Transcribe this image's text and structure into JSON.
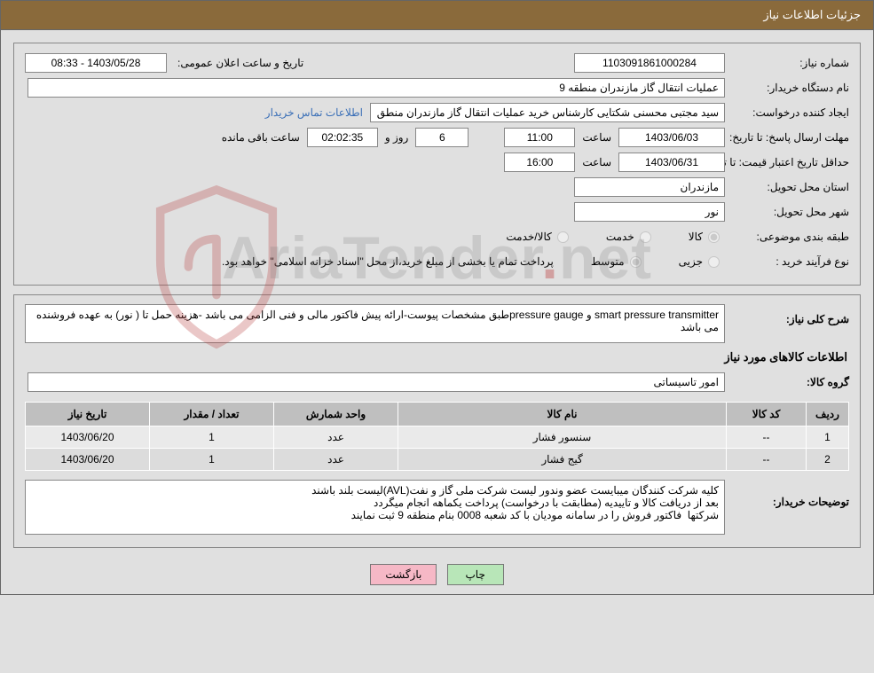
{
  "header": {
    "title": "جزئیات اطلاعات نیاز"
  },
  "info1": {
    "need_number_label": "شماره نیاز:",
    "need_number": "1103091861000284",
    "announce_label": "تاریخ و ساعت اعلان عمومی:",
    "announce_value": "08:33 - 1403/05/28",
    "buyer_org_label": "نام دستگاه خریدار:",
    "buyer_org": "عملیات انتقال گاز مازندران منطقه 9",
    "requester_label": "ایجاد کننده درخواست:",
    "requester": "سید مجتبی محسنی شکتایی کارشناس خرید عملیات انتقال گاز مازندران منطق",
    "contact_link": "اطلاعات تماس خریدار",
    "reply_deadline_label": "مهلت ارسال پاسخ:  تا تاریخ:",
    "reply_date": "1403/06/03",
    "time_label": "ساعت",
    "reply_time": "11:00",
    "days_value": "6",
    "days_label": "روز و",
    "countdown": "02:02:35",
    "remaining_label": "ساعت باقی مانده",
    "validity_label": "حداقل تاریخ اعتبار قیمت: تا تاریخ:",
    "validity_date": "1403/06/31",
    "validity_time": "16:00",
    "province_label": "استان محل تحویل:",
    "province": "مازندران",
    "city_label": "شهر محل تحویل:",
    "city": "نور",
    "category_label": "طبقه بندی موضوعی:",
    "cat_goods": "کالا",
    "cat_service": "خدمت",
    "cat_goods_service": "کالا/خدمت",
    "process_label": "نوع فرآیند خرید :",
    "proc_small": "جزیی",
    "proc_medium": "متوسط",
    "process_note": "پرداخت تمام یا بخشی از مبلغ خرید،از محل \"اسناد خزانه اسلامی\" خواهد بود."
  },
  "info2": {
    "summary_label": "شرح کلی نیاز:",
    "summary_text": "smart pressure transmitter و pressure gaugeطبق مشخصات پیوست-ارائه پیش فاکتور مالی و فنی الزامی می باشد -هزینه حمل تا ( نور) به عهده فروشنده می باشد",
    "items_section_title": "اطلاعات کالاهای مورد نیاز",
    "group_label": "گروه کالا:",
    "group_value": "امور تاسیساتی",
    "th_row": "ردیف",
    "th_code": "کد کالا",
    "th_name": "نام کالا",
    "th_unit": "واحد شمارش",
    "th_qty": "تعداد / مقدار",
    "th_date": "تاریخ نیاز",
    "rows": [
      {
        "idx": "1",
        "code": "--",
        "name": "سنسور فشار",
        "unit": "عدد",
        "qty": "1",
        "date": "1403/06/20"
      },
      {
        "idx": "2",
        "code": "--",
        "name": "گیج فشار",
        "unit": "عدد",
        "qty": "1",
        "date": "1403/06/20"
      }
    ],
    "buyer_notes_label": "توضیحات خریدار:",
    "buyer_notes_text": "کلیه شرکت کنندگان میبایست عضو وندور لیست شرکت ملی گاز و نفت(AVL)لیست بلند باشند\nبعد از دریافت کالا و تاییدیه (مطابقت با درخواست) پرداخت یکماهه انجام میگردد\nشرکتها  فاکتور فروش را در سامانه مودیان با کد شعبه 0008 بنام منطقه 9 ثبت نمایند"
  },
  "buttons": {
    "print": "چاپ",
    "back": "بازگشت"
  },
  "watermark": {
    "text_a": "AriaTender",
    "dot": ".",
    "text_b": "ne",
    "text_c": "t"
  },
  "chart_data": {
    "type": "table",
    "title": "اطلاعات کالاهای مورد نیاز",
    "columns": [
      "ردیف",
      "کد کالا",
      "نام کالا",
      "واحد شمارش",
      "تعداد / مقدار",
      "تاریخ نیاز"
    ],
    "rows": [
      [
        "1",
        "--",
        "سنسور فشار",
        "عدد",
        "1",
        "1403/06/20"
      ],
      [
        "2",
        "--",
        "گیج فشار",
        "عدد",
        "1",
        "1403/06/20"
      ]
    ]
  }
}
